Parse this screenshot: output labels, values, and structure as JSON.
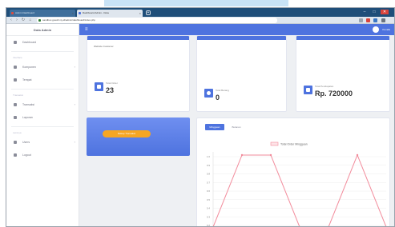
{
  "banner": {
    "caption": ""
  },
  "browser": {
    "tabs": [
      {
        "label": "Admin Dashboard"
      },
      {
        "label": "Dashboard Admin - Dota"
      }
    ],
    "new_tab": "+",
    "url": "sandbox.gosoft.my.id/admin/dashboard/index.php",
    "window_controls": [
      "–",
      "□",
      "✕"
    ],
    "nav": [
      "‹",
      "›",
      "↻",
      "⌂"
    ],
    "colors": {
      "tabbar": "#1f4e79",
      "toolbar": "#dfe6ee"
    }
  },
  "sidebar": {
    "brand": "Dota Admin",
    "sections": [
      {
        "heading": "",
        "items": [
          {
            "label": "Dashboard",
            "icon": "gauge-icon",
            "has_children": false
          }
        ]
      },
      {
        "heading": "Interface",
        "items": [
          {
            "label": "Komponen",
            "icon": "cog-icon",
            "has_children": true
          },
          {
            "label": "Tempat",
            "icon": "map-icon",
            "has_children": false
          }
        ]
      },
      {
        "heading": "Transaksi",
        "items": [
          {
            "label": "Transaksi",
            "icon": "exchange-icon",
            "has_children": true
          },
          {
            "label": "Laporan",
            "icon": "report-icon",
            "has_children": false
          }
        ]
      },
      {
        "heading": "Lainnya",
        "items": [
          {
            "label": "Users",
            "icon": "users-icon",
            "has_children": true
          },
          {
            "label": "Logout",
            "icon": "logout-icon",
            "has_children": false
          }
        ]
      }
    ]
  },
  "topbar": {
    "menu_icon": "≡",
    "user": "Pemilik",
    "accent": "#4e73df"
  },
  "cards": [
    {
      "label": "Website Customer",
      "stat_label": "",
      "value": ""
    },
    {
      "label": "",
      "stat_label": "Total Order",
      "value": "23"
    },
    {
      "label": "",
      "stat_label": "Total Barang",
      "value": "0"
    },
    {
      "label": "",
      "stat_label": "Total Pendapatan",
      "value": "Rp. 720000"
    }
  ],
  "promo": {
    "button": "Rekap Transaksi"
  },
  "chart_panel": {
    "tabs": [
      "Mingguan",
      "Bulanan"
    ]
  },
  "chart_data": {
    "type": "line",
    "legend": "Total Order Mingguan",
    "legend_position": "top",
    "x": [
      0,
      1,
      2,
      3,
      4,
      5,
      6
    ],
    "values": [
      0,
      1,
      1,
      0,
      0,
      1,
      0
    ],
    "ylim": [
      0,
      1
    ],
    "y_ticks": [
      "1.0",
      "0.9",
      "0.8",
      "0.7",
      "0.6",
      "0.5",
      "0.4",
      "0.3",
      "0.2"
    ],
    "line_color": "#f28b9b",
    "grid": true
  }
}
